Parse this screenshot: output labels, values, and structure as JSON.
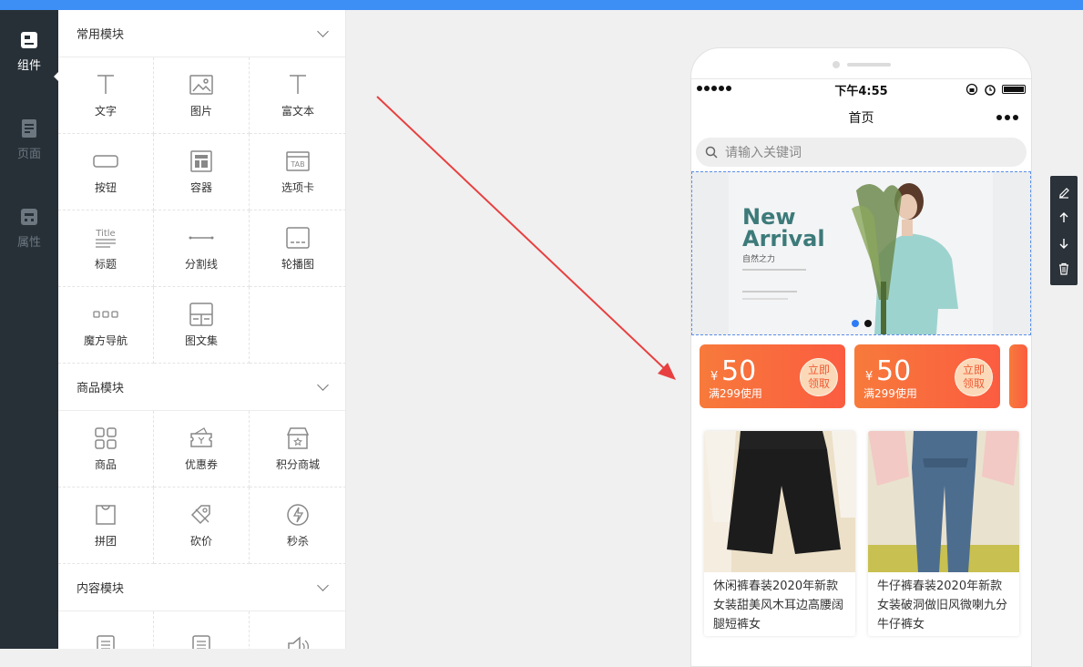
{
  "rail": {
    "items": [
      {
        "label": "组件",
        "icon": "component-icon",
        "active": true
      },
      {
        "label": "页面",
        "icon": "page-icon",
        "active": false
      },
      {
        "label": "属性",
        "icon": "property-icon",
        "active": false
      }
    ]
  },
  "panel": {
    "sections": [
      {
        "title": "常用模块",
        "items": [
          {
            "label": "文字",
            "icon": "text-icon"
          },
          {
            "label": "图片",
            "icon": "image-icon"
          },
          {
            "label": "富文本",
            "icon": "rich-text-icon"
          },
          {
            "label": "按钮",
            "icon": "button-icon"
          },
          {
            "label": "容器",
            "icon": "container-icon"
          },
          {
            "label": "选项卡",
            "icon": "tab-icon"
          },
          {
            "label": "标题",
            "icon": "title-icon"
          },
          {
            "label": "分割线",
            "icon": "divider-icon"
          },
          {
            "label": "轮播图",
            "icon": "carousel-icon"
          },
          {
            "label": "魔方导航",
            "icon": "cube-nav-icon"
          },
          {
            "label": "图文集",
            "icon": "image-text-icon"
          }
        ]
      },
      {
        "title": "商品模块",
        "items": [
          {
            "label": "商品",
            "icon": "goods-icon"
          },
          {
            "label": "优惠券",
            "icon": "coupon-icon"
          },
          {
            "label": "积分商城",
            "icon": "points-mall-icon"
          },
          {
            "label": "拼团",
            "icon": "group-buy-icon"
          },
          {
            "label": "砍价",
            "icon": "bargain-icon"
          },
          {
            "label": "秒杀",
            "icon": "flash-sale-icon"
          }
        ]
      },
      {
        "title": "内容模块",
        "items": [
          {
            "label": "",
            "icon": "article-icon"
          },
          {
            "label": "",
            "icon": "article-list-icon"
          },
          {
            "label": "",
            "icon": "audio-icon"
          }
        ]
      }
    ]
  },
  "tab_icon_text": "TAB",
  "title_icon_text": "Title",
  "phone": {
    "time": "下午4:55",
    "nav_title": "首页",
    "search_placeholder": "请输入关键词",
    "banner": {
      "headline1": "New",
      "headline2": "Arrival",
      "subtitle": "自然之力"
    },
    "coupons": [
      {
        "currency": "¥",
        "amount": "50",
        "condition": "满299使用",
        "action1": "立即",
        "action2": "领取"
      },
      {
        "currency": "¥",
        "amount": "50",
        "condition": "满299使用",
        "action1": "立即",
        "action2": "领取"
      }
    ],
    "goods": [
      {
        "name": "休闲裤春装2020年新款女装甜美风木耳边高腰阔腿短裤女"
      },
      {
        "name": "牛仔裤春装2020年新款女装破洞做旧风微喇九分牛仔裤女"
      }
    ]
  },
  "colors": {
    "topbar": "#3d8ff5",
    "rail_bg": "#273037",
    "coupon_start": "#f77a3b",
    "coupon_end": "#fb5c40",
    "arrow": "#e84040",
    "selection": "#5a8ee8",
    "active_dot": "#2d7cf6"
  }
}
